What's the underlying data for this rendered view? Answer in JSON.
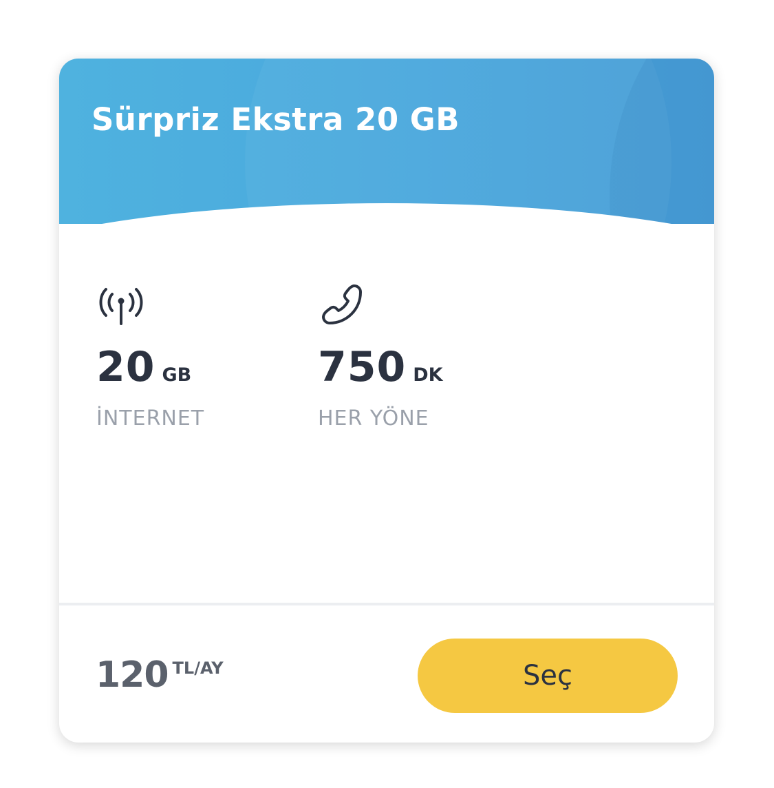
{
  "package": {
    "title": "Sürpriz Ekstra 20 GB"
  },
  "features": [
    {
      "icon": "antenna-signal-icon",
      "amount": "20",
      "unit": "GB",
      "label": "İNTERNET"
    },
    {
      "icon": "phone-icon",
      "amount": "750",
      "unit": "DK",
      "label": "HER YÖNE"
    }
  ],
  "price": {
    "amount": "120",
    "period": "TL/AY"
  },
  "actions": {
    "select_label": "Seç"
  },
  "colors": {
    "header": "#4aa8dd",
    "button": "#f5c842",
    "text_dark": "#2b3240",
    "text_muted": "#9aa0aa"
  }
}
